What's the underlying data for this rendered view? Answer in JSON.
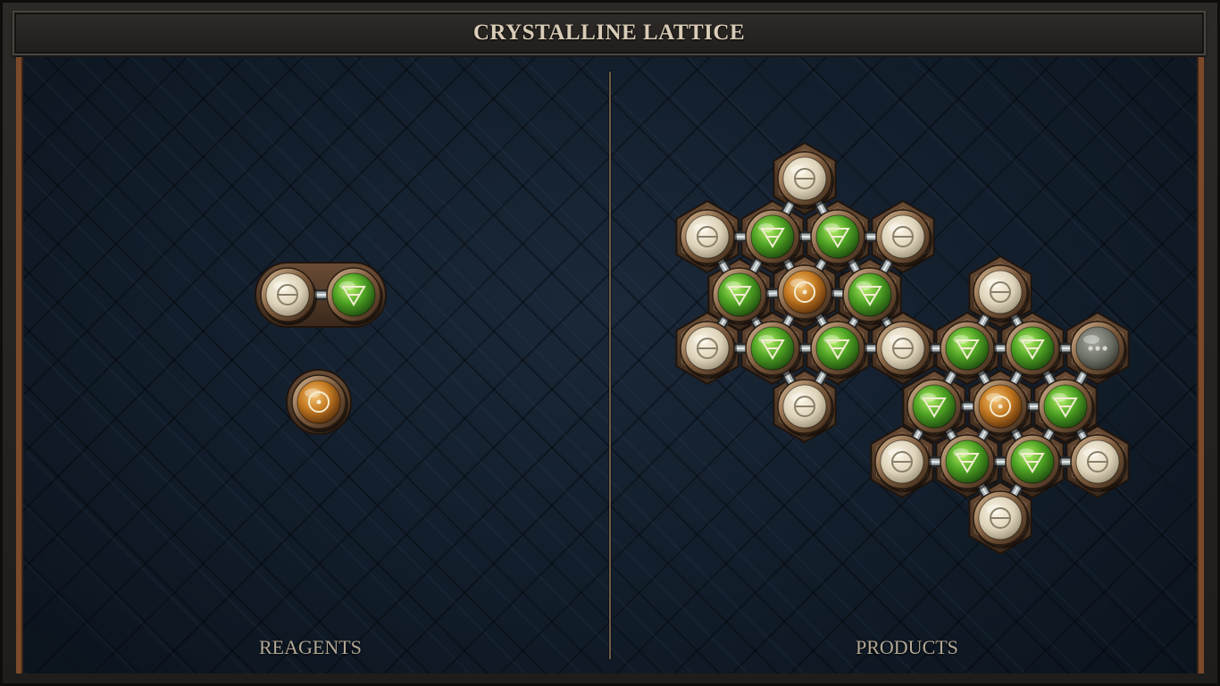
{
  "title": "CRYSTALLINE LATTICE",
  "panels": {
    "reagents_label": "REAGENTS",
    "products_label": "PRODUCTS"
  },
  "element_types": {
    "salt": {
      "icon": "salt-icon",
      "color": "#e6dcc4"
    },
    "earth": {
      "icon": "earth-icon",
      "color": "#4fa424"
    },
    "gold": {
      "icon": "gold-icon",
      "color": "#c47a22"
    },
    "quintessence": {
      "icon": "quintessence-icon",
      "color": "#6b6f66"
    }
  },
  "reagents": [
    {
      "name": "reagent-salt-earth",
      "atoms": [
        "salt",
        "earth"
      ]
    },
    {
      "name": "reagent-gold",
      "atoms": [
        "gold"
      ]
    }
  ],
  "products": [
    {
      "name": "product-lattice-a",
      "atoms": [
        "salt",
        "salt",
        "earth",
        "earth",
        "salt",
        "earth",
        "gold",
        "earth",
        "salt",
        "earth",
        "earth",
        "salt",
        "salt"
      ]
    },
    {
      "name": "product-lattice-b",
      "atoms": [
        "salt",
        "earth",
        "earth",
        "quintessence",
        "earth",
        "gold",
        "earth",
        "salt",
        "earth",
        "earth",
        "salt",
        "salt"
      ]
    }
  ]
}
